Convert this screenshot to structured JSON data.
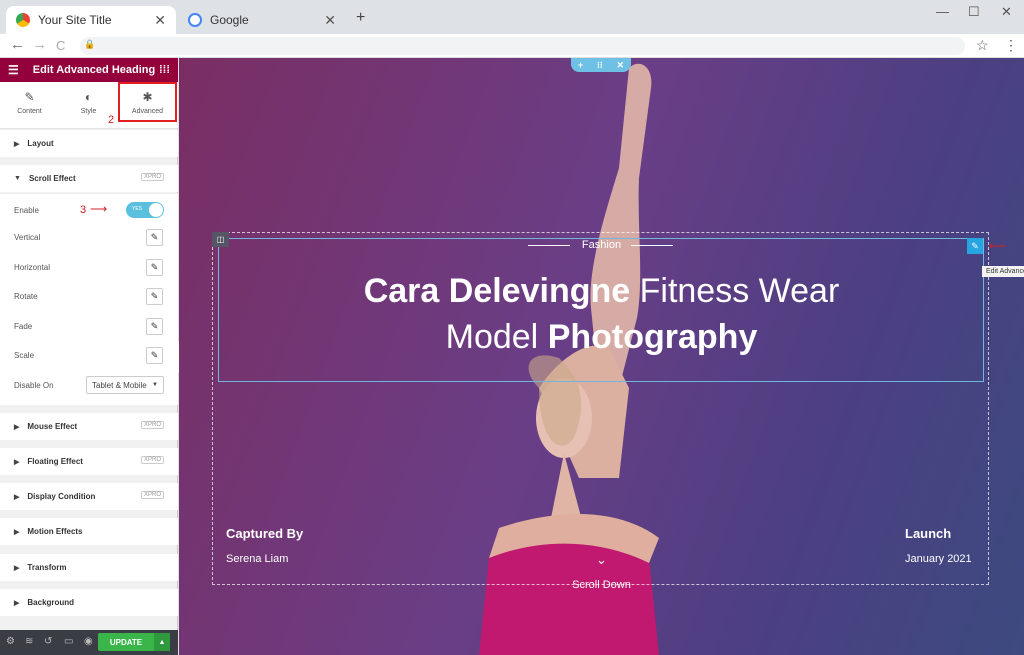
{
  "browser": {
    "tabs": [
      {
        "title": "Your Site Title"
      },
      {
        "title": "Google"
      }
    ],
    "new_tab": "+",
    "nav_back": "←",
    "nav_forward": "→",
    "nav_reload": "C",
    "lock": "🔒",
    "star": "☆",
    "menu": "⋮",
    "close_tab": "✕",
    "win_min": "—",
    "win_max": "☐",
    "win_close": "✕"
  },
  "panel": {
    "title": "Edit Advanced Heading",
    "tabs": [
      {
        "label": "Content",
        "icon": "✎"
      },
      {
        "label": "Style",
        "icon": "◐"
      },
      {
        "label": "Advanced",
        "icon": "✱"
      }
    ],
    "step2": "2",
    "step3": "3",
    "sections": {
      "layout": "Layout",
      "scroll_effect": "Scroll Effect",
      "mouse_effect": "Mouse Effect",
      "floating_effect": "Floating Effect",
      "display_condition": "Display Condition",
      "motion_effects": "Motion Effects",
      "transform": "Transform",
      "background": "Background"
    },
    "pro_badge": "XPRO",
    "fields": {
      "enable": "Enable",
      "toggle_state": "YES",
      "vertical": "Vertical",
      "horizontal": "Horizontal",
      "rotate": "Rotate",
      "fade": "Fade",
      "scale": "Scale",
      "disable_on": "Disable On",
      "disable_on_value": "Tablet & Mobile"
    },
    "update": "UPDATE"
  },
  "canvas": {
    "section_tools": [
      "+",
      "⁝⁝",
      "✕"
    ],
    "kicker": "Fashion",
    "title_line1_bold": "Cara Delevingne",
    "title_line1_light": " Fitness Wear",
    "title_line2_light": "Model ",
    "title_line2_bold": "Photography",
    "tooltip": "Edit Advanced Heading",
    "captured_label": "Captured By",
    "captured_value": "Serena Liam",
    "launch_label": "Launch",
    "launch_value": "January 2021",
    "scroll_label": "Scroll Down"
  },
  "colors": {
    "panel_header": "#93003c",
    "update_green": "#39b54a",
    "accent_blue": "#71b6dd"
  }
}
